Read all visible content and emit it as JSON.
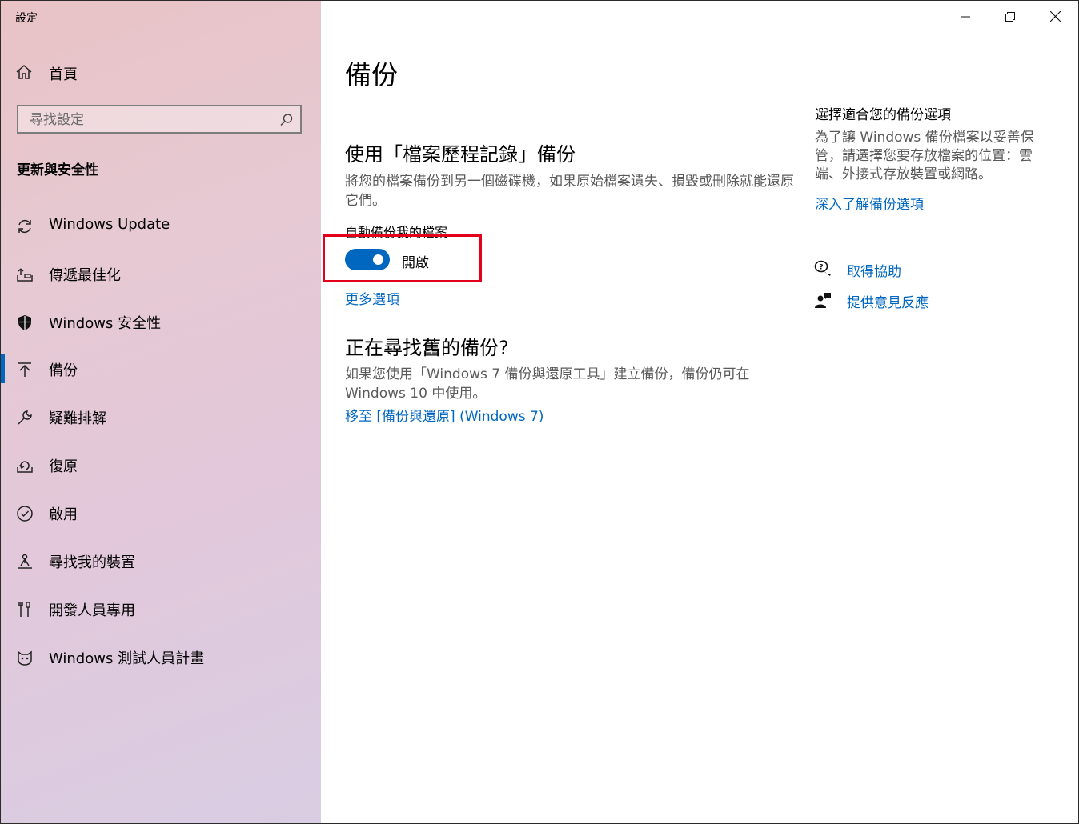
{
  "window": {
    "title": "設定",
    "controls": {
      "minimize": "minimize-icon",
      "restore": "restore-icon",
      "close": "close-icon"
    }
  },
  "sidebar": {
    "home_label": "首頁",
    "search_placeholder": "尋找設定",
    "section_title": "更新與安全性",
    "items": [
      {
        "label": "Windows Update",
        "icon": "sync-icon",
        "selected": false
      },
      {
        "label": "傳遞最佳化",
        "icon": "delivery-optimization-icon",
        "selected": false
      },
      {
        "label": "Windows 安全性",
        "icon": "shield-icon",
        "selected": false
      },
      {
        "label": "備份",
        "icon": "backup-arrow-icon",
        "selected": true
      },
      {
        "label": "疑難排解",
        "icon": "wrench-icon",
        "selected": false
      },
      {
        "label": "復原",
        "icon": "recovery-icon",
        "selected": false
      },
      {
        "label": "啟用",
        "icon": "check-circle-icon",
        "selected": false
      },
      {
        "label": "尋找我的裝置",
        "icon": "find-device-icon",
        "selected": false
      },
      {
        "label": "開發人員專用",
        "icon": "developer-tools-icon",
        "selected": false
      },
      {
        "label": "Windows 測試人員計畫",
        "icon": "insider-cat-icon",
        "selected": false
      }
    ]
  },
  "main": {
    "title": "備份",
    "file_history": {
      "heading": "使用「檔案歷程記錄」備份",
      "description": "將您的檔案備份到另一個磁碟機，如果原始檔案遺失、損毀或刪除就能還原它們。",
      "auto_backup_label": "自動備份我的檔案",
      "toggle_state": "開啟",
      "toggle_on": true,
      "more_options_link": "更多選項"
    },
    "old_backup": {
      "heading": "正在尋找舊的備份?",
      "description": "如果您使用「Windows 7 備份與還原工具」建立備份，備份仍可在 Windows 10 中使用。",
      "link": "移至 [備份與還原] (Windows 7)"
    }
  },
  "right_panel": {
    "title": "選擇適合您的備份選項",
    "description": "為了讓 Windows 備份檔案以妥善保管，請選擇您要存放檔案的位置：雲端、外接式存放裝置或網路。",
    "learn_more_link": "深入了解備份選項",
    "help_link": "取得協助",
    "feedback_link": "提供意見反應"
  },
  "colors": {
    "accent": "#0067c0",
    "highlight_box": "#e3001b"
  }
}
